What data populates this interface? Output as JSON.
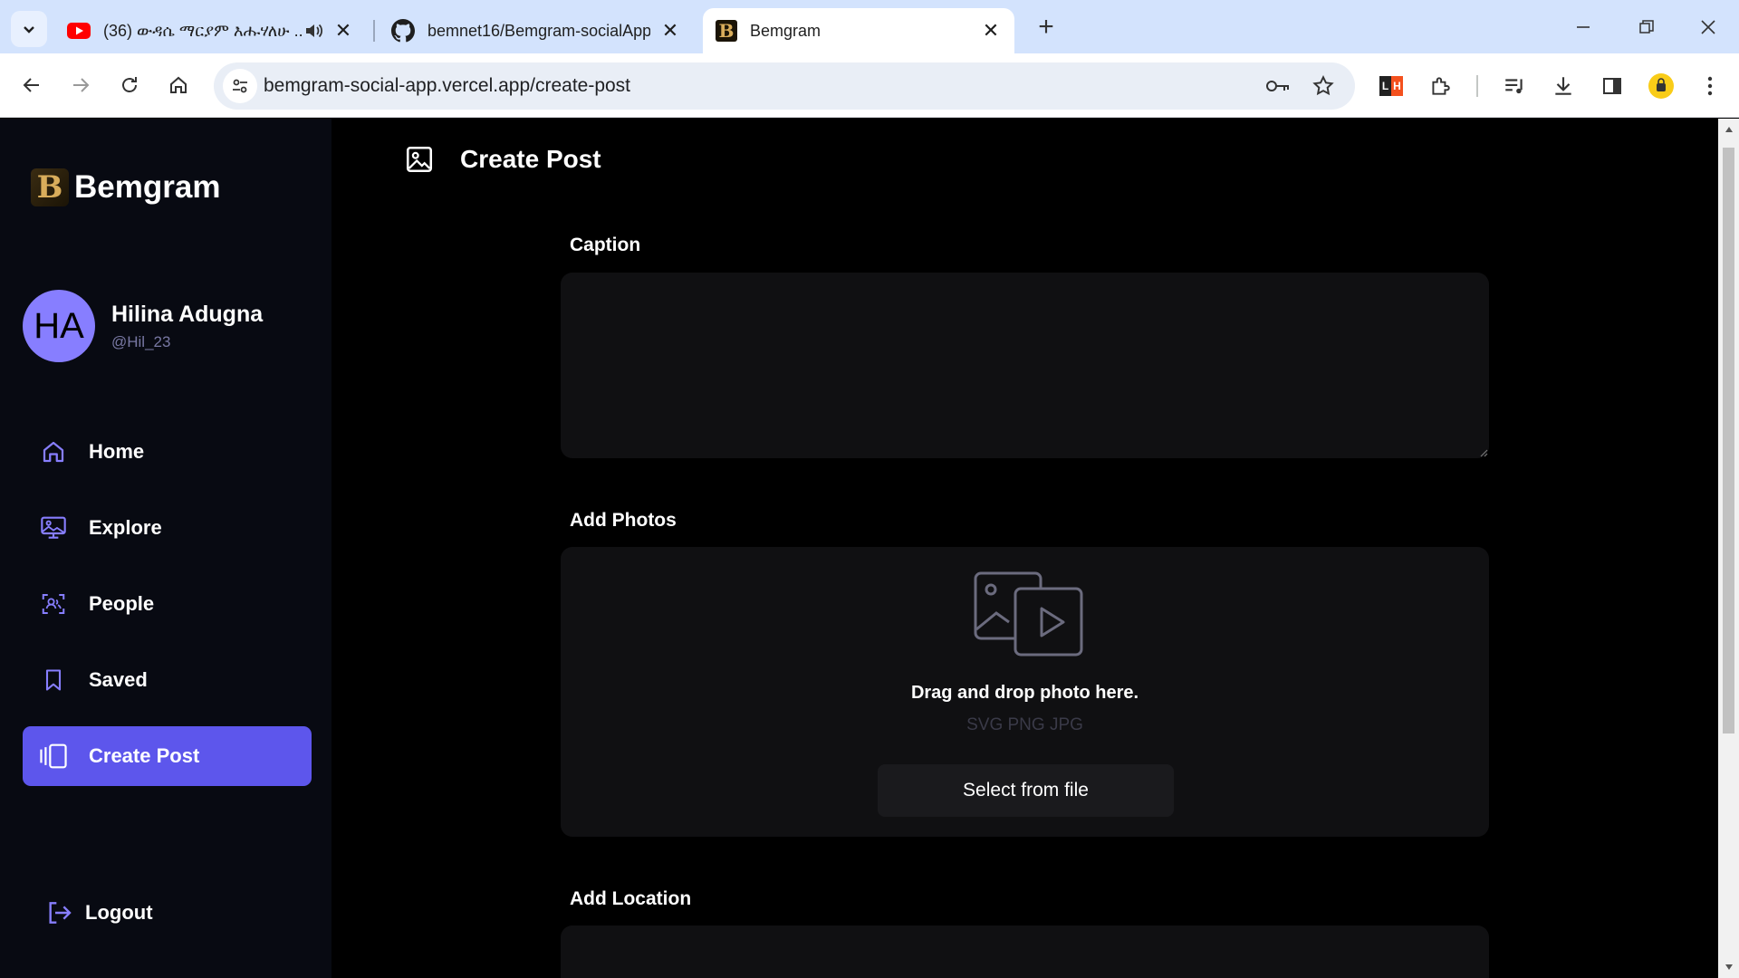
{
  "browser": {
    "tabs": [
      {
        "title": "(36) ውዳሴ ማርያም እሑሃለሁ ..",
        "favicon": "youtube-icon"
      },
      {
        "title": "bemnet16/Bemgram-socialApp",
        "favicon": "github-icon"
      },
      {
        "title": "Bemgram",
        "favicon": "bemgram-icon"
      }
    ],
    "url": "bemgram-social-app.vercel.app/create-post",
    "accent": "#d3e3fd"
  },
  "app": {
    "brand": "Bemgram",
    "profile": {
      "initials": "HA",
      "name": "Hilina Adugna",
      "handle": "@Hil_23"
    },
    "nav": [
      {
        "label": "Home",
        "icon": "home-icon"
      },
      {
        "label": "Explore",
        "icon": "explore-icon"
      },
      {
        "label": "People",
        "icon": "people-icon"
      },
      {
        "label": "Saved",
        "icon": "bookmark-icon"
      },
      {
        "label": "Create Post",
        "icon": "create-post-icon",
        "active": true
      }
    ],
    "logout": "Logout",
    "colors": {
      "primary": "#5d56ec",
      "avatar": "#877eff",
      "sidebar": "#080a12"
    }
  },
  "main": {
    "title": "Create Post",
    "caption_label": "Caption",
    "caption_value": "",
    "photos_label": "Add Photos",
    "photo_hint": "Drag and drop photo here.",
    "photo_types": "SVG PNG JPG",
    "select_button": "Select from file",
    "location_label": "Add Location",
    "location_value": ""
  }
}
